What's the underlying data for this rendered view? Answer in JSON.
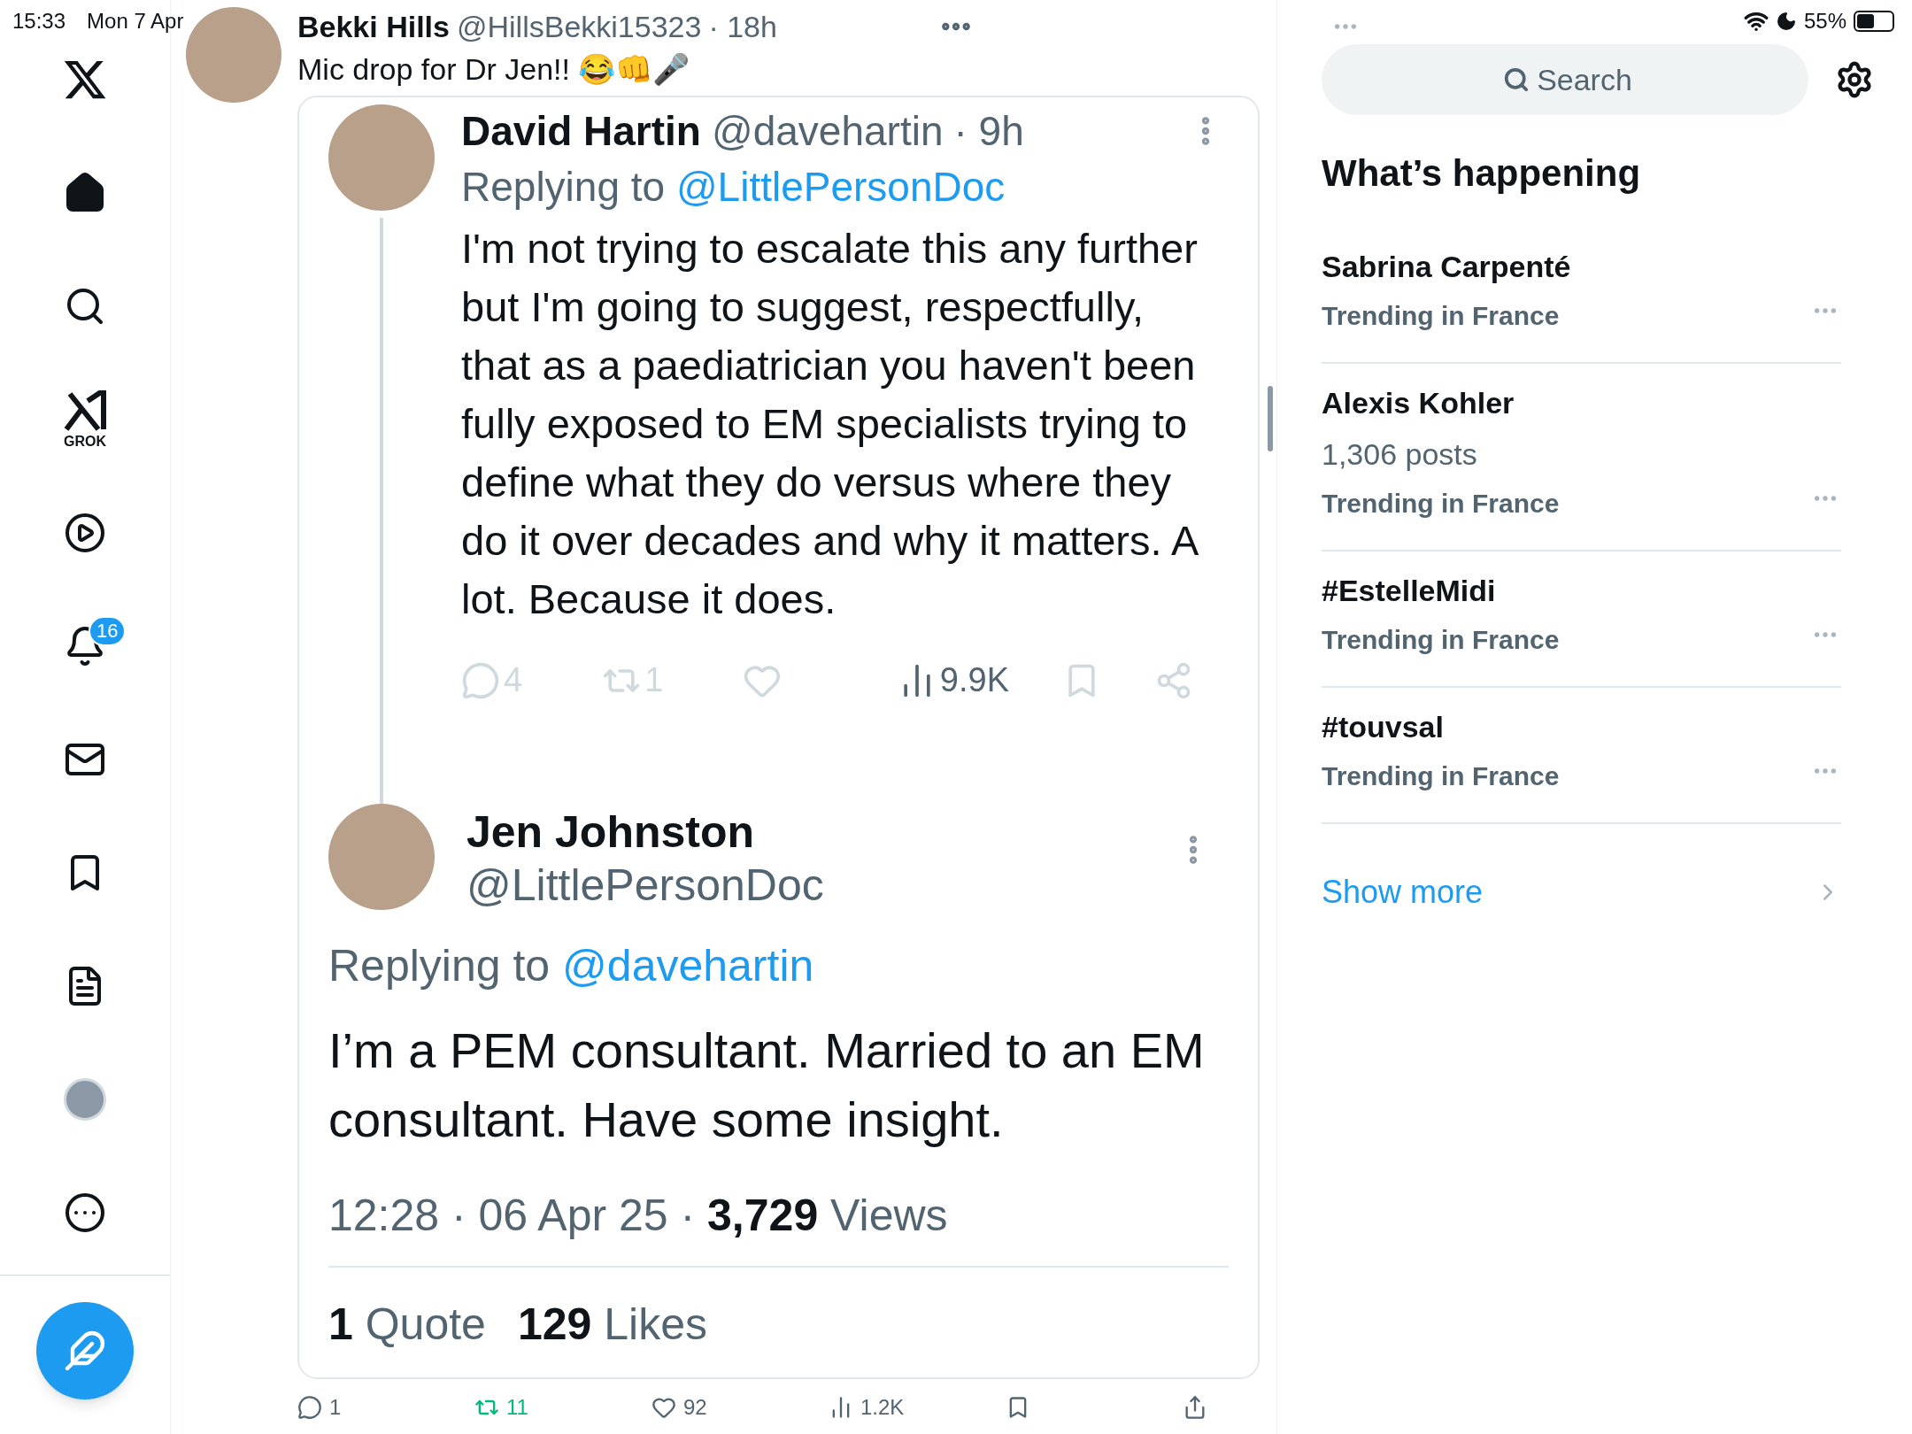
{
  "status_bar": {
    "time": "15:33",
    "date": "Mon 7 Apr",
    "battery": "55%"
  },
  "nav": {
    "items": [
      {
        "kind": "logo",
        "selected": false
      },
      {
        "kind": "home",
        "selected": true
      },
      {
        "kind": "search",
        "selected": false
      },
      {
        "kind": "grok",
        "label": "GROK",
        "selected": false
      },
      {
        "kind": "video",
        "selected": false
      },
      {
        "kind": "notifications",
        "badge": "16",
        "selected": false
      },
      {
        "kind": "messages",
        "selected": false
      },
      {
        "kind": "bookmarks",
        "selected": false
      },
      {
        "kind": "lists",
        "selected": false
      },
      {
        "kind": "profile",
        "selected": false
      },
      {
        "kind": "more",
        "selected": false
      }
    ]
  },
  "post": {
    "author": "Bekki Hills",
    "handle": "@HillsBekki15323",
    "time": "· 18h",
    "text": "Mic drop for Dr Jen!! 😂👊🎤",
    "quoted": {
      "reply": {
        "author": "David Hartin",
        "handle": "@davehartin",
        "time": "· 9h",
        "replying_label": "Replying to",
        "replying_to": "@LittlePersonDoc",
        "text": "I'm not trying to escalate this any further but I'm going to suggest, respectfully, that as a paediatrician you haven't been fully exposed to EM specialists trying to define what they do versus where they do it over decades and why it matters. A lot. Because it does.",
        "actions": [
          {
            "kind": "reply",
            "count": "4"
          },
          {
            "kind": "repost",
            "count": "1"
          },
          {
            "kind": "like"
          },
          {
            "kind": "views",
            "count": "9.9K"
          },
          {
            "kind": "bookmark"
          },
          {
            "kind": "share"
          }
        ]
      },
      "main": {
        "author": "Jen Johnston",
        "handle": "@LittlePersonDoc",
        "replying_label": "Replying to",
        "replying_to": "@davehartin",
        "text": "I’m a PEM consultant. Married to an EM consultant. Have some insight.",
        "timestamp": "12:28 · 06 Apr 25 · ",
        "views": "3,729",
        "views_label": "Views",
        "stats": [
          {
            "count": "1",
            "label": "Quote"
          },
          {
            "count": "129",
            "label": "Likes"
          }
        ]
      }
    },
    "actions": [
      {
        "kind": "reply",
        "count": "1",
        "active": false
      },
      {
        "kind": "repost",
        "count": "11",
        "active": true
      },
      {
        "kind": "like",
        "count": "92",
        "active": false
      },
      {
        "kind": "views",
        "count": "1.2K",
        "active": false
      },
      {
        "kind": "bookmark",
        "active": false
      },
      {
        "kind": "share",
        "active": false
      }
    ]
  },
  "sidebar": {
    "search": {
      "placeholder": "Search"
    },
    "title": "What’s happening",
    "trends": [
      {
        "name": "Sabrina Carpenté",
        "context": "Trending in France"
      },
      {
        "name": "Alexis Kohler",
        "posts": "1,306 posts",
        "context": "Trending in France"
      },
      {
        "name": "#EstelleMidi",
        "context": "Trending in France"
      },
      {
        "name": "#touvsal",
        "context": "Trending in France"
      }
    ],
    "show_more": "Show more"
  }
}
